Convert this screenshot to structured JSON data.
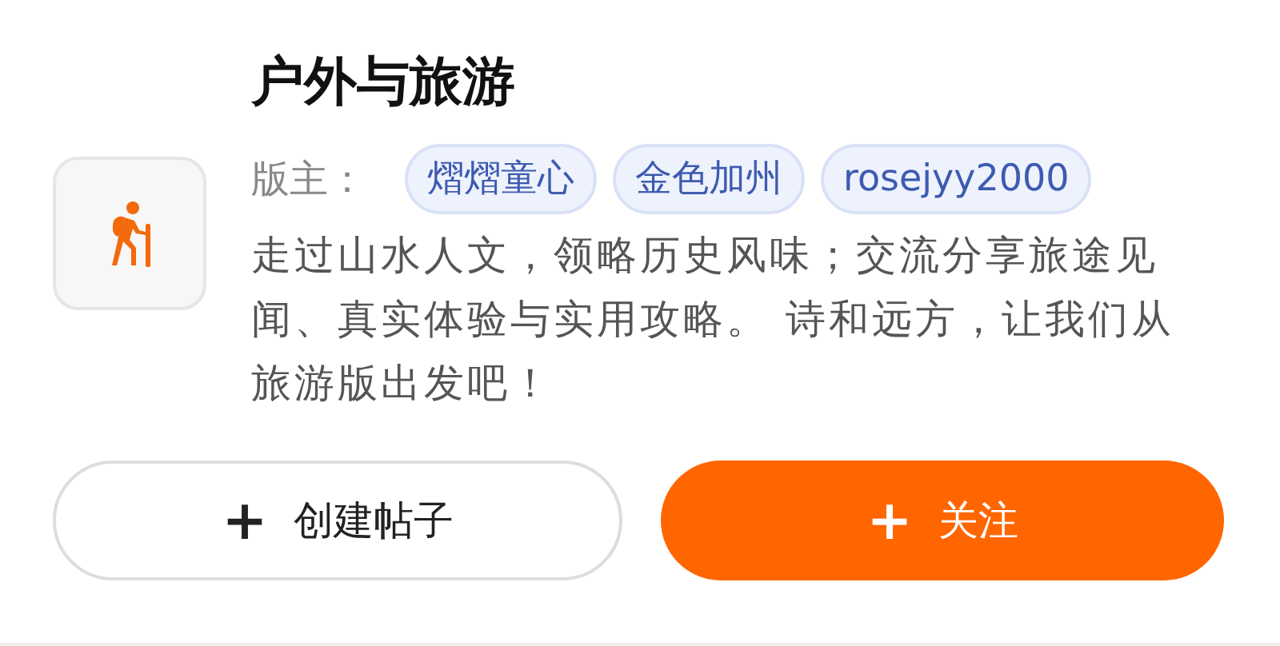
{
  "forum": {
    "title": "户外与旅游",
    "moderators_label": "版主：",
    "moderators": [
      "熠熠童心",
      "金色加州",
      "rosejyy2000"
    ],
    "description": "走过山水人文，领略历史风味；交流分享旅途见闻、真实体验与实用攻略。 诗和远方，让我们从旅游版出发吧！"
  },
  "buttons": [
    {
      "kind": "outline",
      "icon": "+",
      "label": "创建帖子"
    },
    {
      "kind": "primary",
      "icon": "+",
      "label": "关注"
    }
  ]
}
